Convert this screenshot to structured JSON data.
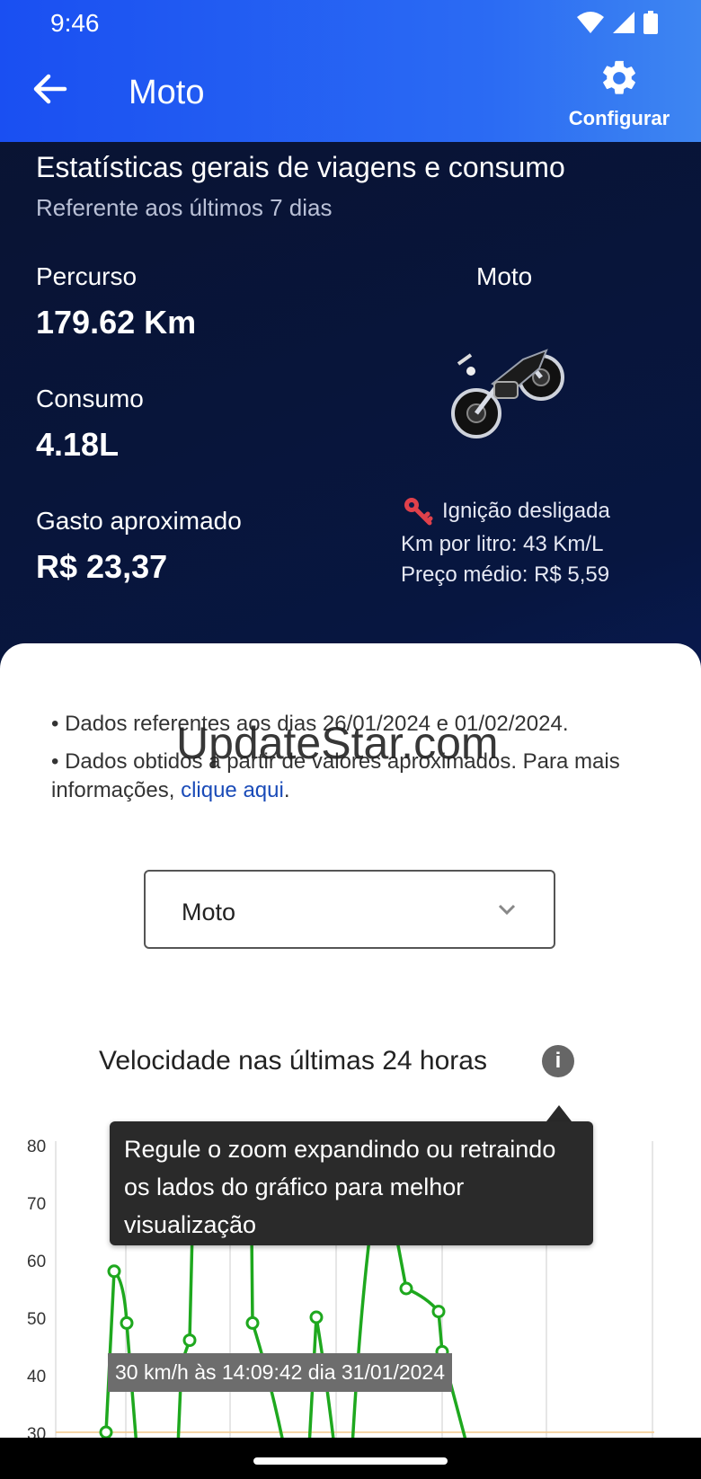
{
  "status": {
    "time": "9:46"
  },
  "header": {
    "title": "Moto",
    "config_label": "Configurar"
  },
  "stats": {
    "title": "Estatísticas gerais de viagens e consumo",
    "subtitle": "Referente aos últimos 7 dias",
    "percurso_label": "Percurso",
    "percurso_value": "179.62 Km",
    "consumo_label": "Consumo",
    "consumo_value": "4.18L",
    "gasto_label": "Gasto aproximado",
    "gasto_value": "R$ 23,37",
    "vehicle_label": "Moto",
    "ignition": "Ignição desligada",
    "km_litro": "Km por litro: 43 Km/L",
    "preco_medio": "Preço médio: R$ 5,59"
  },
  "notes": {
    "line1": "• Dados referentes aos dias 26/01/2024 e 01/02/2024.",
    "line2_prefix": "• Dados obtidos a partir de valores aproximados. Para mais informações, ",
    "line2_link": "clique aqui",
    "line2_suffix": "."
  },
  "watermark": "UpdateStar.com",
  "vehicle_select": {
    "value": "Moto"
  },
  "chart_section": {
    "title": "Velocidade nas últimas 24 horas",
    "info_glyph": "i",
    "tooltip": "Regule o zoom expandindo ou retraindo os lados do gráfico para melhor visualização",
    "point_label": "30 km/h às 14:09:42 dia 31/01/2024"
  },
  "colors": {
    "accent": "#1a4ff2",
    "line": "#1ea81e",
    "key": "#e0414b"
  },
  "icons": {
    "back": "arrow-left-icon",
    "config": "gear-icon",
    "ignition": "key-icon",
    "info": "info-icon",
    "dropdown": "chevron-down-icon"
  },
  "chart_data": {
    "type": "line",
    "ylim": [
      25,
      80
    ],
    "yticks": [
      30,
      40,
      50,
      60,
      70,
      80
    ],
    "reference_line": 30,
    "series": [
      {
        "values": [
          30,
          58,
          49,
          42,
          46,
          49,
          50,
          55,
          51,
          44
        ]
      }
    ]
  }
}
